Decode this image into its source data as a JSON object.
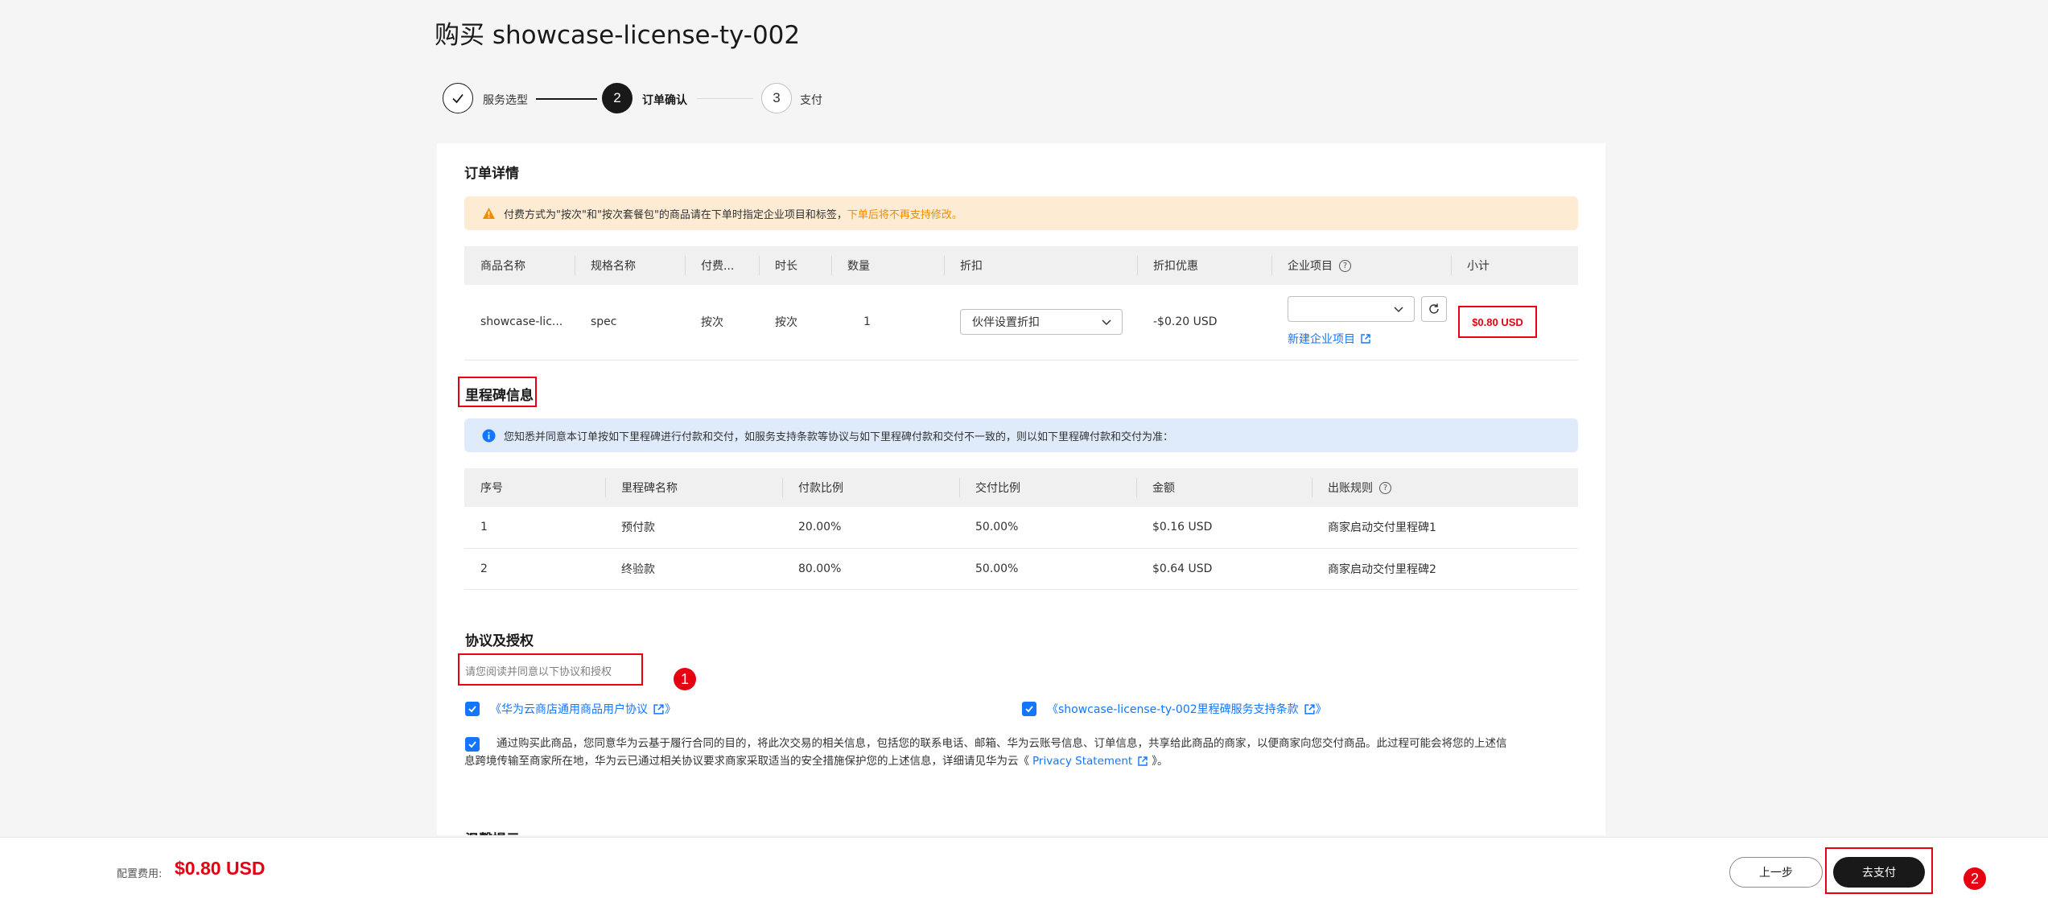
{
  "page": {
    "title": "购买 showcase-license-ty-002"
  },
  "steps": [
    {
      "index": "1",
      "label": "服务选型",
      "state": "done"
    },
    {
      "index": "2",
      "label": "订单确认",
      "state": "active"
    },
    {
      "index": "3",
      "label": "支付",
      "state": "pending"
    }
  ],
  "order": {
    "title": "订单详情",
    "warning_text": "付费方式为\"按次\"和\"按次套餐包\"的商品请在下单时指定企业项目和标签，",
    "warning_highlight": "下单后将不再支持修改。",
    "headers": [
      "商品名称",
      "规格名称",
      "付费...",
      "时长",
      "数量",
      "折扣",
      "折扣优惠",
      "企业项目",
      "小计"
    ],
    "row": {
      "product": "showcase-lic...",
      "spec": "spec",
      "pay_type": "按次",
      "duration": "按次",
      "quantity": "1",
      "discount_select": "伙伴设置折扣",
      "discount_amount": "-$0.20 USD",
      "enterprise_project": "",
      "new_project_link": "新建企业项目",
      "subtotal": "$0.80 USD"
    }
  },
  "milestone": {
    "title": "里程碑信息",
    "info_text": "您知悉并同意本订单按如下里程碑进行付款和交付，如服务支持条款等协议与如下里程碑付款和交付不一致的，则以如下里程碑付款和交付为准：",
    "headers": [
      "序号",
      "里程碑名称",
      "付款比例",
      "交付比例",
      "金额",
      "出账规则"
    ],
    "rows": [
      [
        "1",
        "预付款",
        "20.00%",
        "50.00%",
        "$0.16 USD",
        "商家启动交付里程碑1"
      ],
      [
        "2",
        "终验款",
        "80.00%",
        "50.00%",
        "$0.64 USD",
        "商家启动交付里程碑2"
      ]
    ]
  },
  "agreement": {
    "title": "协议及授权",
    "hint": "请您阅读并同意以下协议和授权",
    "item1": "《华为云商店通用商品用户协议",
    "item1_close": "》",
    "item2": "《showcase-license-ty-002里程碑服务支持条款",
    "item2_close": "》",
    "consent_line1": "通过购买此商品，您同意华为云基于履行合同的目的，将此次交易的相关信息，包括您的联系电话、邮箱、华为云账号信息、订单信息，共享给此商品的商家，以便商家向您交付商品。此过程可能会将您的上述信",
    "consent_line2_a": "息跨境传输至商家所在地，华为云已通过相关协议要求商家采取适当的安全措施保护您的上述信息，详细请见华为云《",
    "consent_link": "Privacy Statement",
    "consent_line2_b": "》。",
    "next_section_partial": "温馨提示"
  },
  "annotations": {
    "marker1": "1",
    "marker2": "2"
  },
  "footer": {
    "fee_label": "配置费用:",
    "fee_value": "$0.80 USD",
    "prev_button": "上一步",
    "pay_button": "去支付"
  },
  "colors": {
    "accent": "#1476ff",
    "danger": "#e60012",
    "warning": "#f08c00",
    "dark": "#191919"
  }
}
